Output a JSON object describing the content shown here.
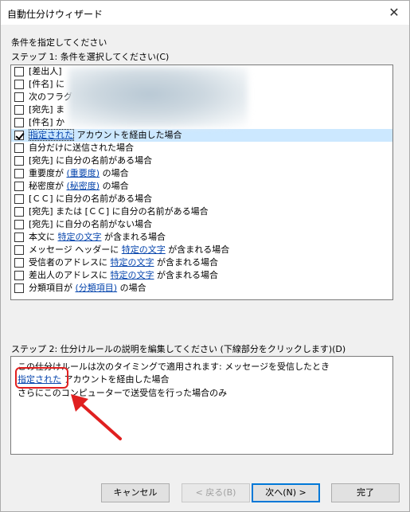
{
  "window": {
    "title": "自動仕分けウィザード",
    "close_glyph": "✕"
  },
  "heading": "条件を指定してください",
  "step1_label": "ステップ 1: 条件を選択してください(C)",
  "conditions": [
    {
      "pre": "[差出人]",
      "link": "",
      "post": "",
      "checked": false
    },
    {
      "pre": "[件名] に",
      "link": "",
      "post": "",
      "checked": false
    },
    {
      "pre": "次のフラグ",
      "link": "",
      "post": "",
      "checked": false
    },
    {
      "pre": "[宛先] ま",
      "link": "",
      "post": "",
      "checked": false
    },
    {
      "pre": "[件名] か",
      "link": "",
      "post": "",
      "checked": false
    },
    {
      "pre": "",
      "link": "指定された",
      "post": " アカウントを経由した場合",
      "checked": true,
      "selected": true
    },
    {
      "pre": "自分だけに送信された場合",
      "link": "",
      "post": "",
      "checked": false
    },
    {
      "pre": "[宛先] に自分の名前がある場合",
      "link": "",
      "post": "",
      "checked": false
    },
    {
      "pre": "重要度が ",
      "link": "(重要度)",
      "post": " の場合",
      "checked": false
    },
    {
      "pre": "秘密度が ",
      "link": "(秘密度)",
      "post": " の場合",
      "checked": false
    },
    {
      "pre": "[ＣＣ] に自分の名前がある場合",
      "link": "",
      "post": "",
      "checked": false
    },
    {
      "pre": "[宛先] または [ＣＣ] に自分の名前がある場合",
      "link": "",
      "post": "",
      "checked": false
    },
    {
      "pre": "[宛先] に自分の名前がない場合",
      "link": "",
      "post": "",
      "checked": false
    },
    {
      "pre": "本文に ",
      "link": "特定の文字",
      "post": " が含まれる場合",
      "checked": false
    },
    {
      "pre": "メッセージ ヘッダーに ",
      "link": "特定の文字",
      "post": " が含まれる場合",
      "checked": false
    },
    {
      "pre": "受信者のアドレスに ",
      "link": "特定の文字",
      "post": " が含まれる場合",
      "checked": false
    },
    {
      "pre": "差出人のアドレスに ",
      "link": "特定の文字",
      "post": " が含まれる場合",
      "checked": false
    },
    {
      "pre": "分類項目が ",
      "link": "(分類項目)",
      "post": " の場合",
      "checked": false
    }
  ],
  "step2_label": "ステップ 2: 仕分けルールの説明を編集してください (下線部分をクリックします)(D)",
  "description": {
    "line1": "この仕分けルールは次のタイミングで適用されます: メッセージを受信したとき",
    "line2_link": "指定された",
    "line2_post": " アカウントを経由した場合",
    "line3": "さらにこのコンピューターで送受信を行った場合のみ"
  },
  "buttons": {
    "cancel": "キャンセル",
    "back": "< 戻る(B)",
    "next": "次へ(N) >",
    "finish": "完了"
  },
  "colors": {
    "link": "#0645ad",
    "selection": "#cce8ff",
    "annotation": "#e02020",
    "default_border": "#0078d7"
  }
}
